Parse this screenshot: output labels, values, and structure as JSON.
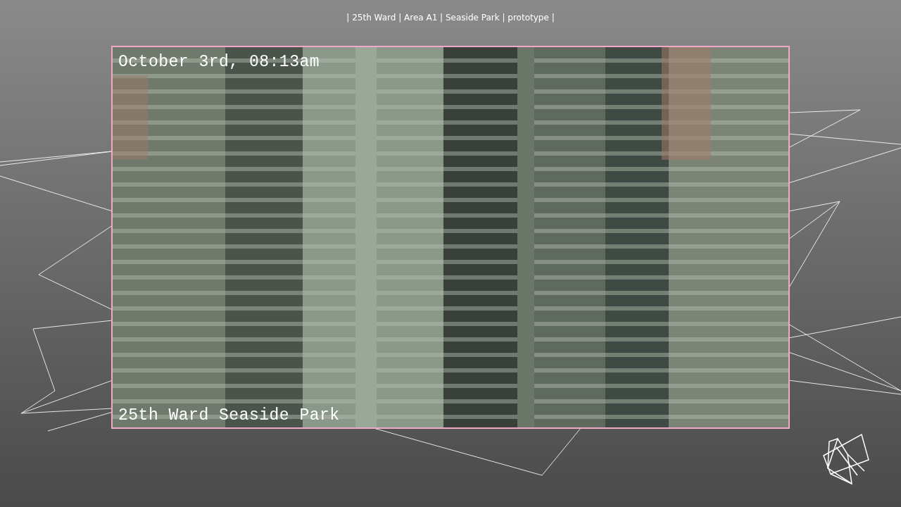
{
  "header": {
    "title": "| 25th Ward | Area A1 | Seaside Park | prototype |"
  },
  "camera_feed": {
    "timestamp": "October 3rd, 08:13am",
    "location": "25th Ward Seaside Park"
  }
}
